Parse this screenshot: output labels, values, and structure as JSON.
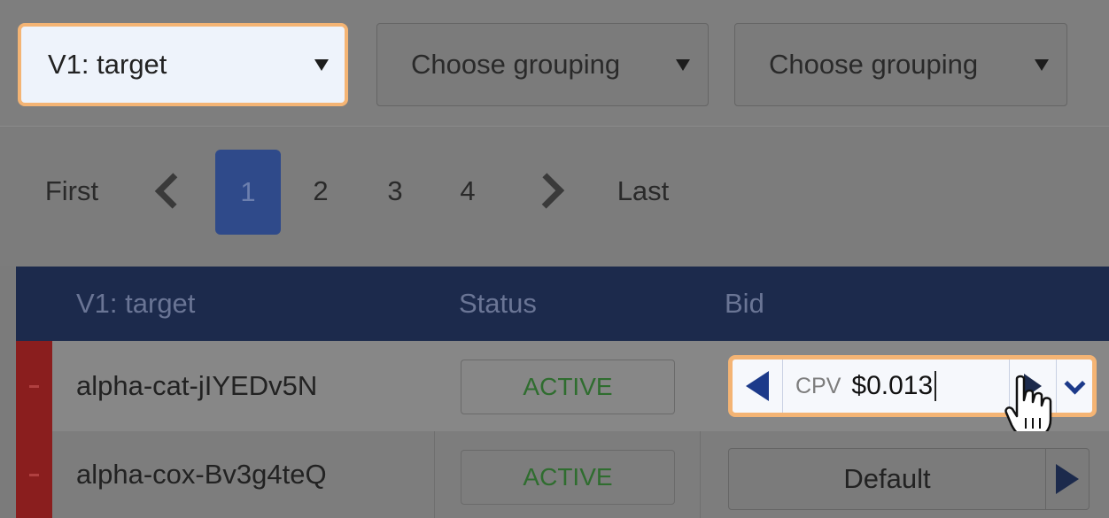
{
  "toolbar": {
    "dropdown_primary": "V1: target",
    "grouping_1": "Choose grouping",
    "grouping_2": "Choose grouping"
  },
  "pagination": {
    "first": "First",
    "pages": [
      "1",
      "2",
      "3",
      "4"
    ],
    "active_page": "1",
    "last": "Last"
  },
  "table": {
    "headers": [
      "V1: target",
      "Status",
      "Bid"
    ],
    "rows": [
      {
        "name": "alpha-cat-jIYEDv5N",
        "status": "ACTIVE",
        "bid_label": "CPV",
        "bid_value": "$0.013"
      },
      {
        "name": "alpha-cox-Bv3g4teQ",
        "status": "ACTIVE",
        "bid_default": "Default"
      }
    ]
  },
  "colors": {
    "highlight": "#f4b474",
    "header_bg": "#1c2a4c",
    "active_status": "#2f6d2f",
    "row_marker": "#8a1e1e"
  }
}
